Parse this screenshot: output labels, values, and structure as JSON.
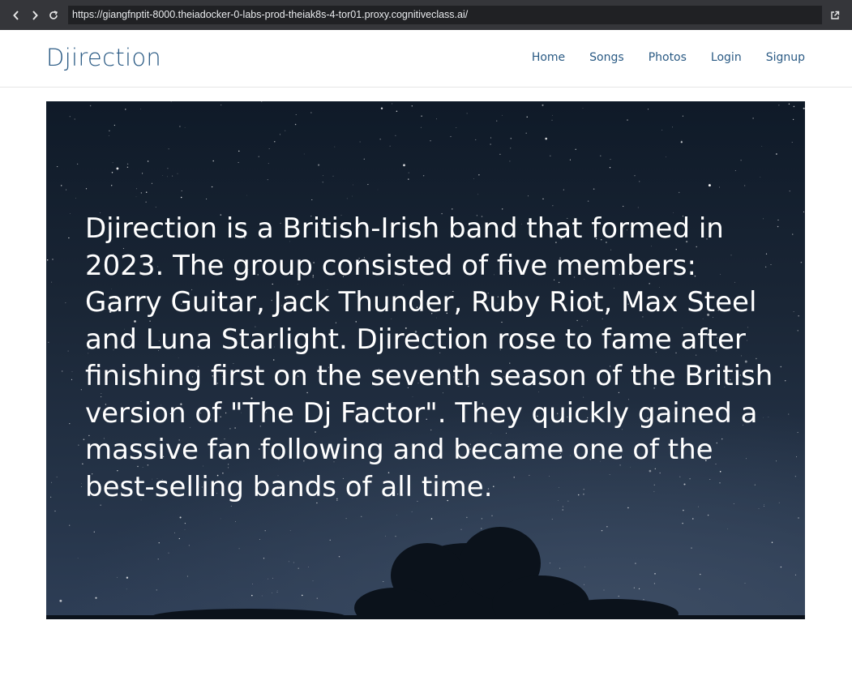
{
  "browser": {
    "url": "https://giangfnptit-8000.theiadocker-0-labs-prod-theiak8s-4-tor01.proxy.cognitiveclass.ai/",
    "icons": [
      "chevron-left-icon",
      "chevron-right-icon",
      "reload-icon",
      "external-link-icon"
    ]
  },
  "header": {
    "brand": "Djirection",
    "nav": [
      "Home",
      "Songs",
      "Photos",
      "Login",
      "Signup"
    ],
    "brand_color": "#2a5a84"
  },
  "hero": {
    "text": "Djirection is a British-Irish band that formed in 2023. The group consisted of five members: Garry Guitar, Jack Thunder, Ruby Riot, Max Steel and Luna Starlight. Djirection rose to fame after finishing first on the seventh season of the British version of \"The Dj Factor\". They quickly gained a massive fan following and became one of the best-selling bands of all time."
  }
}
